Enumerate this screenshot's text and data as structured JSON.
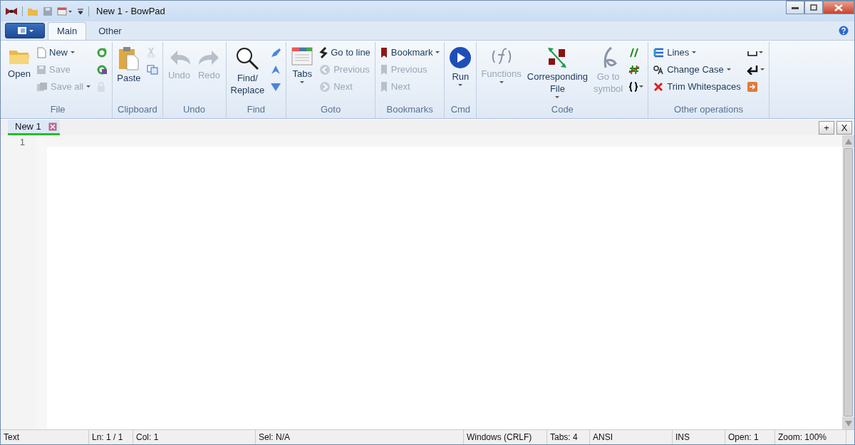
{
  "window": {
    "title": "New 1 - BowPad"
  },
  "ribbon_tabs": [
    {
      "label": "Main",
      "selected": true
    },
    {
      "label": "Other",
      "selected": false
    }
  ],
  "ribbon_groups": [
    {
      "label": "File",
      "columns": [
        [
          {
            "kind": "large",
            "label": "Open",
            "disabled": false,
            "dropdown": false
          }
        ],
        [
          {
            "kind": "small",
            "label": "New",
            "disabled": false,
            "dropdown": true
          },
          {
            "kind": "small",
            "label": "Save",
            "disabled": true,
            "dropdown": false
          },
          {
            "kind": "small",
            "label": "Save all",
            "disabled": true,
            "dropdown": true
          }
        ],
        [
          {
            "kind": "icon",
            "disabled": false,
            "dropdown": false
          },
          {
            "kind": "icon",
            "disabled": false,
            "dropdown": false
          },
          {
            "kind": "icon",
            "disabled": true,
            "dropdown": false
          }
        ]
      ]
    },
    {
      "label": "Clipboard",
      "columns": [
        [
          {
            "kind": "large",
            "label": "Paste",
            "disabled": false,
            "dropdown": false
          }
        ],
        [
          {
            "kind": "icon",
            "disabled": true,
            "dropdown": false
          },
          {
            "kind": "icon",
            "disabled": false,
            "dropdown": false
          }
        ]
      ]
    },
    {
      "label": "Undo",
      "columns": [
        [
          {
            "kind": "large",
            "label": "Undo",
            "disabled": true,
            "dropdown": false
          }
        ],
        [
          {
            "kind": "large",
            "label": "Redo",
            "disabled": true,
            "dropdown": false
          }
        ]
      ]
    },
    {
      "label": "Find",
      "columns": [
        [
          {
            "kind": "large",
            "label": "Find/\nReplace",
            "disabled": false,
            "dropdown": false
          }
        ],
        [
          {
            "kind": "icon",
            "disabled": false,
            "dropdown": false
          },
          {
            "kind": "icon",
            "disabled": false,
            "dropdown": false
          },
          {
            "kind": "icon",
            "disabled": false,
            "dropdown": false
          }
        ]
      ]
    },
    {
      "label": "Goto",
      "columns": [
        [
          {
            "kind": "large",
            "label": "Tabs",
            "disabled": false,
            "dropdown": true
          }
        ],
        [
          {
            "kind": "small",
            "label": "Go to line",
            "disabled": false,
            "dropdown": false
          },
          {
            "kind": "small",
            "label": "Previous",
            "disabled": true,
            "dropdown": false
          },
          {
            "kind": "small",
            "label": "Next",
            "disabled": true,
            "dropdown": false
          }
        ]
      ]
    },
    {
      "label": "Bookmarks",
      "columns": [
        [
          {
            "kind": "small",
            "label": "Bookmark",
            "disabled": false,
            "dropdown": true
          },
          {
            "kind": "small",
            "label": "Previous",
            "disabled": true,
            "dropdown": false
          },
          {
            "kind": "small",
            "label": "Next",
            "disabled": true,
            "dropdown": false
          }
        ]
      ]
    },
    {
      "label": "Cmd",
      "columns": [
        [
          {
            "kind": "large",
            "label": "Run",
            "disabled": false,
            "dropdown": true
          }
        ]
      ]
    },
    {
      "label": "Code",
      "columns": [
        [
          {
            "kind": "large",
            "label": "Functions",
            "disabled": true,
            "dropdown": true
          }
        ],
        [
          {
            "kind": "large",
            "label": "Corresponding\nFile",
            "disabled": false,
            "dropdown": true
          }
        ],
        [
          {
            "kind": "large",
            "label": "Go to\nsymbol",
            "disabled": true,
            "dropdown": false
          }
        ],
        [
          {
            "kind": "icon",
            "disabled": false,
            "dropdown": false
          },
          {
            "kind": "icon",
            "disabled": false,
            "dropdown": false
          },
          {
            "kind": "icon",
            "disabled": false,
            "dropdown": true
          }
        ]
      ]
    },
    {
      "label": "Other operations",
      "columns": [
        [
          {
            "kind": "small",
            "label": "Lines",
            "disabled": false,
            "dropdown": true
          },
          {
            "kind": "small",
            "label": "Change Case",
            "disabled": false,
            "dropdown": true
          },
          {
            "kind": "small",
            "label": "Trim Whitespaces",
            "disabled": false,
            "dropdown": false
          }
        ],
        [
          {
            "kind": "icon",
            "disabled": false,
            "dropdown": true
          },
          {
            "kind": "icon",
            "disabled": false,
            "dropdown": true
          },
          {
            "kind": "icon",
            "disabled": false,
            "dropdown": false
          }
        ]
      ]
    }
  ],
  "document_tabs": [
    {
      "label": "New 1",
      "selected": true
    }
  ],
  "tab_bar_buttons": [
    "+",
    "X"
  ],
  "editor": {
    "line_numbers": [
      "1"
    ]
  },
  "status_bar": [
    "Text",
    "Ln: 1 / 1",
    "Col: 1",
    "Sel: N/A",
    "Windows (CRLF)",
    "Tabs: 4",
    "ANSI",
    "INS",
    "Open: 1",
    "Zoom: 100%"
  ]
}
